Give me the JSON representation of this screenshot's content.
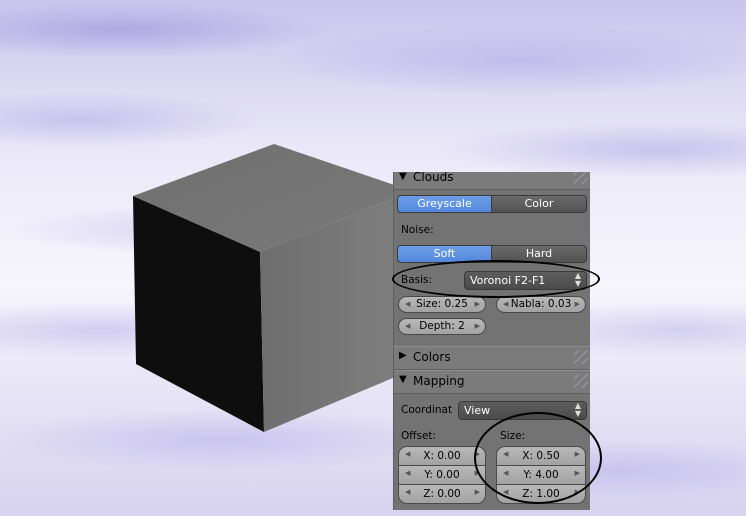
{
  "viewport": {
    "background": "clouds-texture",
    "object": "cube"
  },
  "clouds_panel": {
    "title": "Clouds",
    "type_options": [
      "Greyscale",
      "Color"
    ],
    "type_selected": "Greyscale",
    "noise_label": "Noise:",
    "noise_options": [
      "Soft",
      "Hard"
    ],
    "noise_selected": "Soft",
    "basis_label": "Basis:",
    "basis_value": "Voronoi F2-F1",
    "size": "Size: 0.25",
    "nabla": "Nabla: 0.03",
    "depth": "Depth: 2"
  },
  "colors_panel": {
    "title": "Colors",
    "collapsed": true
  },
  "mapping_panel": {
    "title": "Mapping",
    "coordinate_label": "Coordinat",
    "coordinate_value": "View",
    "offset_label": "Offset:",
    "offset": [
      "X: 0.00",
      "Y: 0.00",
      "Z: 0.00"
    ],
    "size_label": "Size:",
    "size": [
      "X: 0.50",
      "Y: 4.00",
      "Z: 1.00"
    ]
  },
  "colors": {
    "accent": "#5288dd",
    "panel": "#737373",
    "button": "#4b4b4b"
  }
}
